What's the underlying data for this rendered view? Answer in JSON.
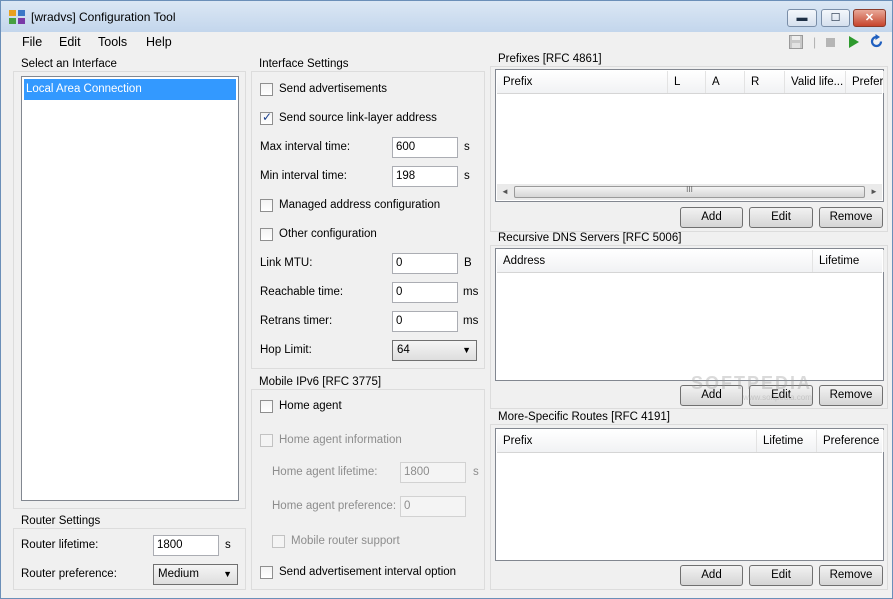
{
  "window": {
    "title": "[wradvs] Configuration Tool",
    "minimize_glyph": "▬",
    "maximize_glyph": "☐",
    "close_glyph": "✕"
  },
  "menu": [
    "File",
    "Edit",
    "Tools",
    "Help"
  ],
  "toolbar": {
    "save_icon": "floppy-disk-icon",
    "stop_icon": "stop-icon",
    "play_icon": "play-icon",
    "refresh_icon": "refresh-icon",
    "separator": "|"
  },
  "interface_panel": {
    "title": "Select an Interface",
    "items": [
      "Local Area Connection"
    ]
  },
  "router_settings": {
    "title": "Router Settings",
    "lifetime_label": "Router lifetime:",
    "lifetime_value": "1800",
    "lifetime_unit": "s",
    "preference_label": "Router preference:",
    "preference_value": "Medium"
  },
  "interface_settings": {
    "title": "Interface Settings",
    "send_adv_label": "Send advertisements",
    "send_sll_label": "Send source link-layer address",
    "max_interval_label": "Max interval time:",
    "max_interval_value": "600",
    "min_interval_label": "Min interval time:",
    "min_interval_value": "198",
    "interval_unit": "s",
    "managed_label": "Managed address configuration",
    "other_label": "Other configuration",
    "mtu_label": "Link MTU:",
    "mtu_value": "0",
    "mtu_unit": "B",
    "reachable_label": "Reachable time:",
    "reachable_value": "0",
    "retrans_label": "Retrans timer:",
    "retrans_value": "0",
    "ms_unit": "ms",
    "hop_label": "Hop Limit:",
    "hop_value": "64",
    "check_glyph": "✓"
  },
  "mobile_ipv6": {
    "title": "Mobile IPv6 [RFC 3775]",
    "home_agent_label": "Home agent",
    "home_agent_info_label": "Home agent information",
    "ha_lifetime_label": "Home agent lifetime:",
    "ha_lifetime_value": "1800",
    "ha_lifetime_unit": "s",
    "ha_pref_label": "Home agent preference:",
    "ha_pref_value": "0",
    "mobile_router_label": "Mobile router support",
    "send_interval_label": "Send advertisement interval option"
  },
  "prefixes": {
    "title": "Prefixes [RFC 4861]",
    "columns": [
      "Prefix",
      "L",
      "A",
      "R",
      "Valid life...",
      "Prefer"
    ],
    "scroll_left": "◄",
    "scroll_right": "►",
    "scroll_grip": "III"
  },
  "dns": {
    "title": "Recursive DNS Servers [RFC 5006]",
    "columns": [
      "Address",
      "Lifetime"
    ]
  },
  "routes": {
    "title": "More-Specific Routes [RFC 4191]",
    "columns": [
      "Prefix",
      "Lifetime",
      "Preference"
    ]
  },
  "buttons": {
    "add": "Add",
    "edit": "Edit",
    "remove": "Remove"
  },
  "dropdown_arrow": "▼",
  "watermark": {
    "text": "SOFTPEDIA",
    "url": "www.softpedia.com"
  }
}
